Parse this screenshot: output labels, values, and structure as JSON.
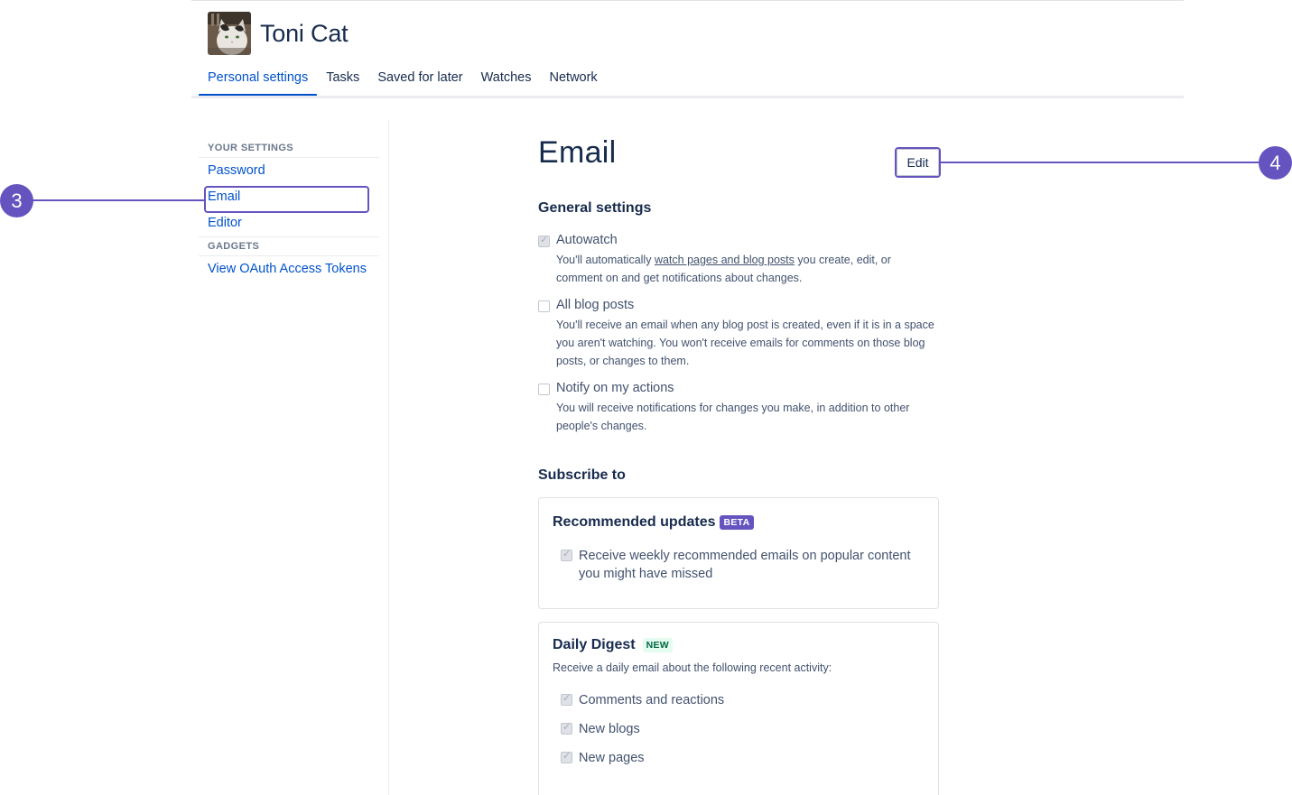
{
  "profile": {
    "name": "Toni Cat",
    "avatar_alt": "cat-avatar"
  },
  "tabs": [
    {
      "label": "Personal settings",
      "active": true
    },
    {
      "label": "Tasks",
      "active": false
    },
    {
      "label": "Saved for later",
      "active": false
    },
    {
      "label": "Watches",
      "active": false
    },
    {
      "label": "Network",
      "active": false
    }
  ],
  "sidebar": {
    "your_settings_heading": "YOUR SETTINGS",
    "items": [
      "Password",
      "Email",
      "Editor"
    ],
    "gadgets_heading": "GADGETS",
    "gadgets": [
      "View OAuth Access Tokens"
    ]
  },
  "main": {
    "title": "Email",
    "edit_label": "Edit",
    "general_heading": "General settings",
    "options": [
      {
        "label": "Autowatch",
        "checked": true,
        "desc_before": "You'll automatically ",
        "desc_link": "watch pages and blog posts",
        "desc_after": " you create, edit, or comment on and get notifications about changes."
      },
      {
        "label": "All blog posts",
        "checked": false,
        "desc": "You'll receive an email when any blog post is created, even if it is in a space you aren't watching. You won't receive emails for comments on those blog posts, or changes to them."
      },
      {
        "label": "Notify on my actions",
        "checked": false,
        "desc": "You will receive notifications for changes you make, in addition to other people's changes."
      }
    ],
    "subscribe_heading": "Subscribe to",
    "recommended": {
      "title": "Recommended updates",
      "badge": "BETA",
      "option": "Receive weekly recommended emails on popular content you might have missed",
      "checked": true
    },
    "digest": {
      "title": "Daily Digest",
      "badge": "NEW",
      "subtitle": "Receive a daily email about the following recent activity:",
      "options": [
        "Comments and reactions",
        "New blogs",
        "New pages"
      ]
    }
  },
  "callouts": {
    "left": "3",
    "right": "4"
  },
  "colors": {
    "accent": "#0052cc",
    "callout": "#6554c0",
    "text": "#172b4d",
    "subtle": "#42526e"
  }
}
